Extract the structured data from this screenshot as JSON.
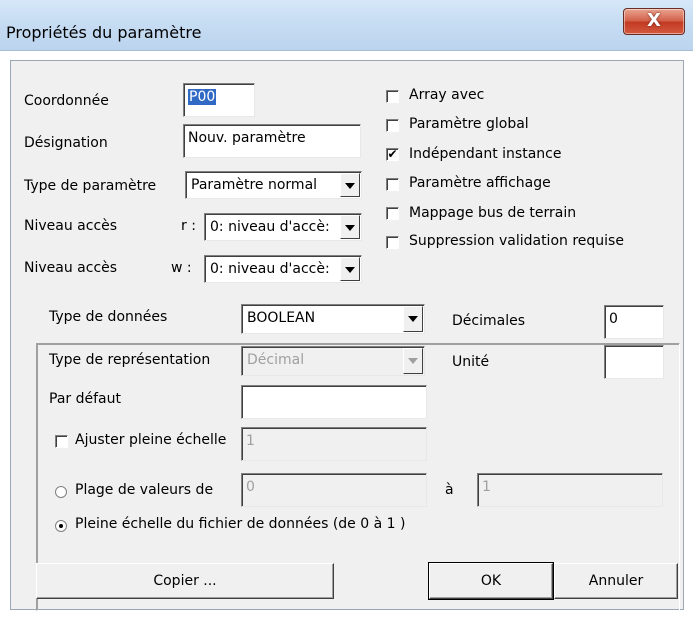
{
  "window": {
    "title": "Propriétés du paramètre",
    "close_label": "X"
  },
  "params": {
    "coord_label": "Coordonnée",
    "coord_value": "P00",
    "desig_label": "Désignation",
    "desig_value": "Nouv. paramètre",
    "type_label": "Type de paramètre",
    "type_value": "Paramètre normal",
    "niveau_r_label": "Niveau accès",
    "niveau_r_suffix": "r :",
    "niveau_r_value": "0: niveau d'accè:",
    "niveau_w_label": "Niveau accès",
    "niveau_w_suffix": "w :",
    "niveau_w_value": "0: niveau d'accè:"
  },
  "options": [
    {
      "label": "Array avec",
      "checked": false
    },
    {
      "label": "Paramètre global",
      "checked": false
    },
    {
      "label": "Indépendant instance",
      "checked": true
    },
    {
      "label": "Paramètre affichage",
      "checked": false
    },
    {
      "label": "Mappage bus de terrain",
      "checked": false
    },
    {
      "label": "Suppression validation requise",
      "checked": false
    }
  ],
  "data": {
    "type_label": "Type de données",
    "type_value": "BOOLEAN",
    "decimales_label": "Décimales",
    "decimales_value": "0",
    "repr_label": "Type de représentation",
    "repr_value": "Décimal",
    "unite_label": "Unité",
    "unite_value": "",
    "defaut_label": "Par défaut",
    "defaut_value": "",
    "ajuster_label": "Ajuster pleine échelle",
    "ajuster_checked": false,
    "ajuster_value": "1",
    "plage_label": "Plage de  valeurs de",
    "plage_from": "0",
    "plage_a_label": "à",
    "plage_to": "1",
    "pleine_label": "Pleine échelle du fichier de données (de 0  à 1 )",
    "selected_radio": "pleine"
  },
  "buttons": {
    "copier": "Copier ...",
    "ok": "OK",
    "annuler": "Annuler"
  },
  "colors": {
    "selection": "#316ac5",
    "close_button": "#c23a22",
    "dialog_bg": "#f0f0f0"
  }
}
